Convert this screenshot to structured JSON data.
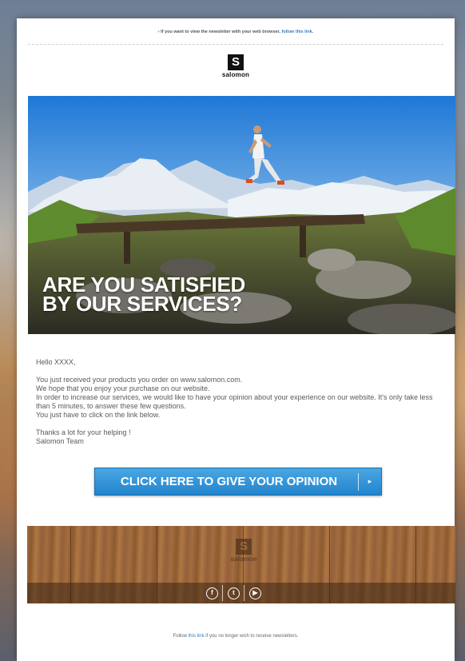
{
  "preheader": {
    "text": "› If you want to view the newsletter with your web browser, ",
    "link": "follow this link."
  },
  "brand": {
    "logo_letter": "S",
    "name": "salomon"
  },
  "hero": {
    "title": "ARE YOU SATISFIED\nBY OUR SERVICES?"
  },
  "message": {
    "greeting": "Hello XXXX,",
    "lines": [
      "You just received your products you order on www.salomon.com.",
      "We hope that you enjoy your purchase on our website.",
      "In order to increase our services, we would like to have your opinion about your experience on our website. It's only take less than 5 minutes, to answer these few questions.",
      "You just have to click on the link below."
    ],
    "thanks": "Thanks a lot for your helping !",
    "signature": "Salomon Team"
  },
  "cta": {
    "label": "CLICK HERE TO GIVE YOUR OPINION",
    "arrow": "▸"
  },
  "footer": {
    "social": [
      {
        "name": "facebook-icon",
        "glyph": "f"
      },
      {
        "name": "twitter-icon",
        "glyph": "t"
      },
      {
        "name": "youtube-icon",
        "glyph": "▶"
      }
    ],
    "unsubscribe_prefix": "Follow ",
    "unsubscribe_link": "this link",
    "unsubscribe_suffix": " if you no longer wish to receive newsletters."
  },
  "colors": {
    "accent": "#2284cc",
    "link": "#3b7bbf",
    "wood": "#9c6738"
  }
}
